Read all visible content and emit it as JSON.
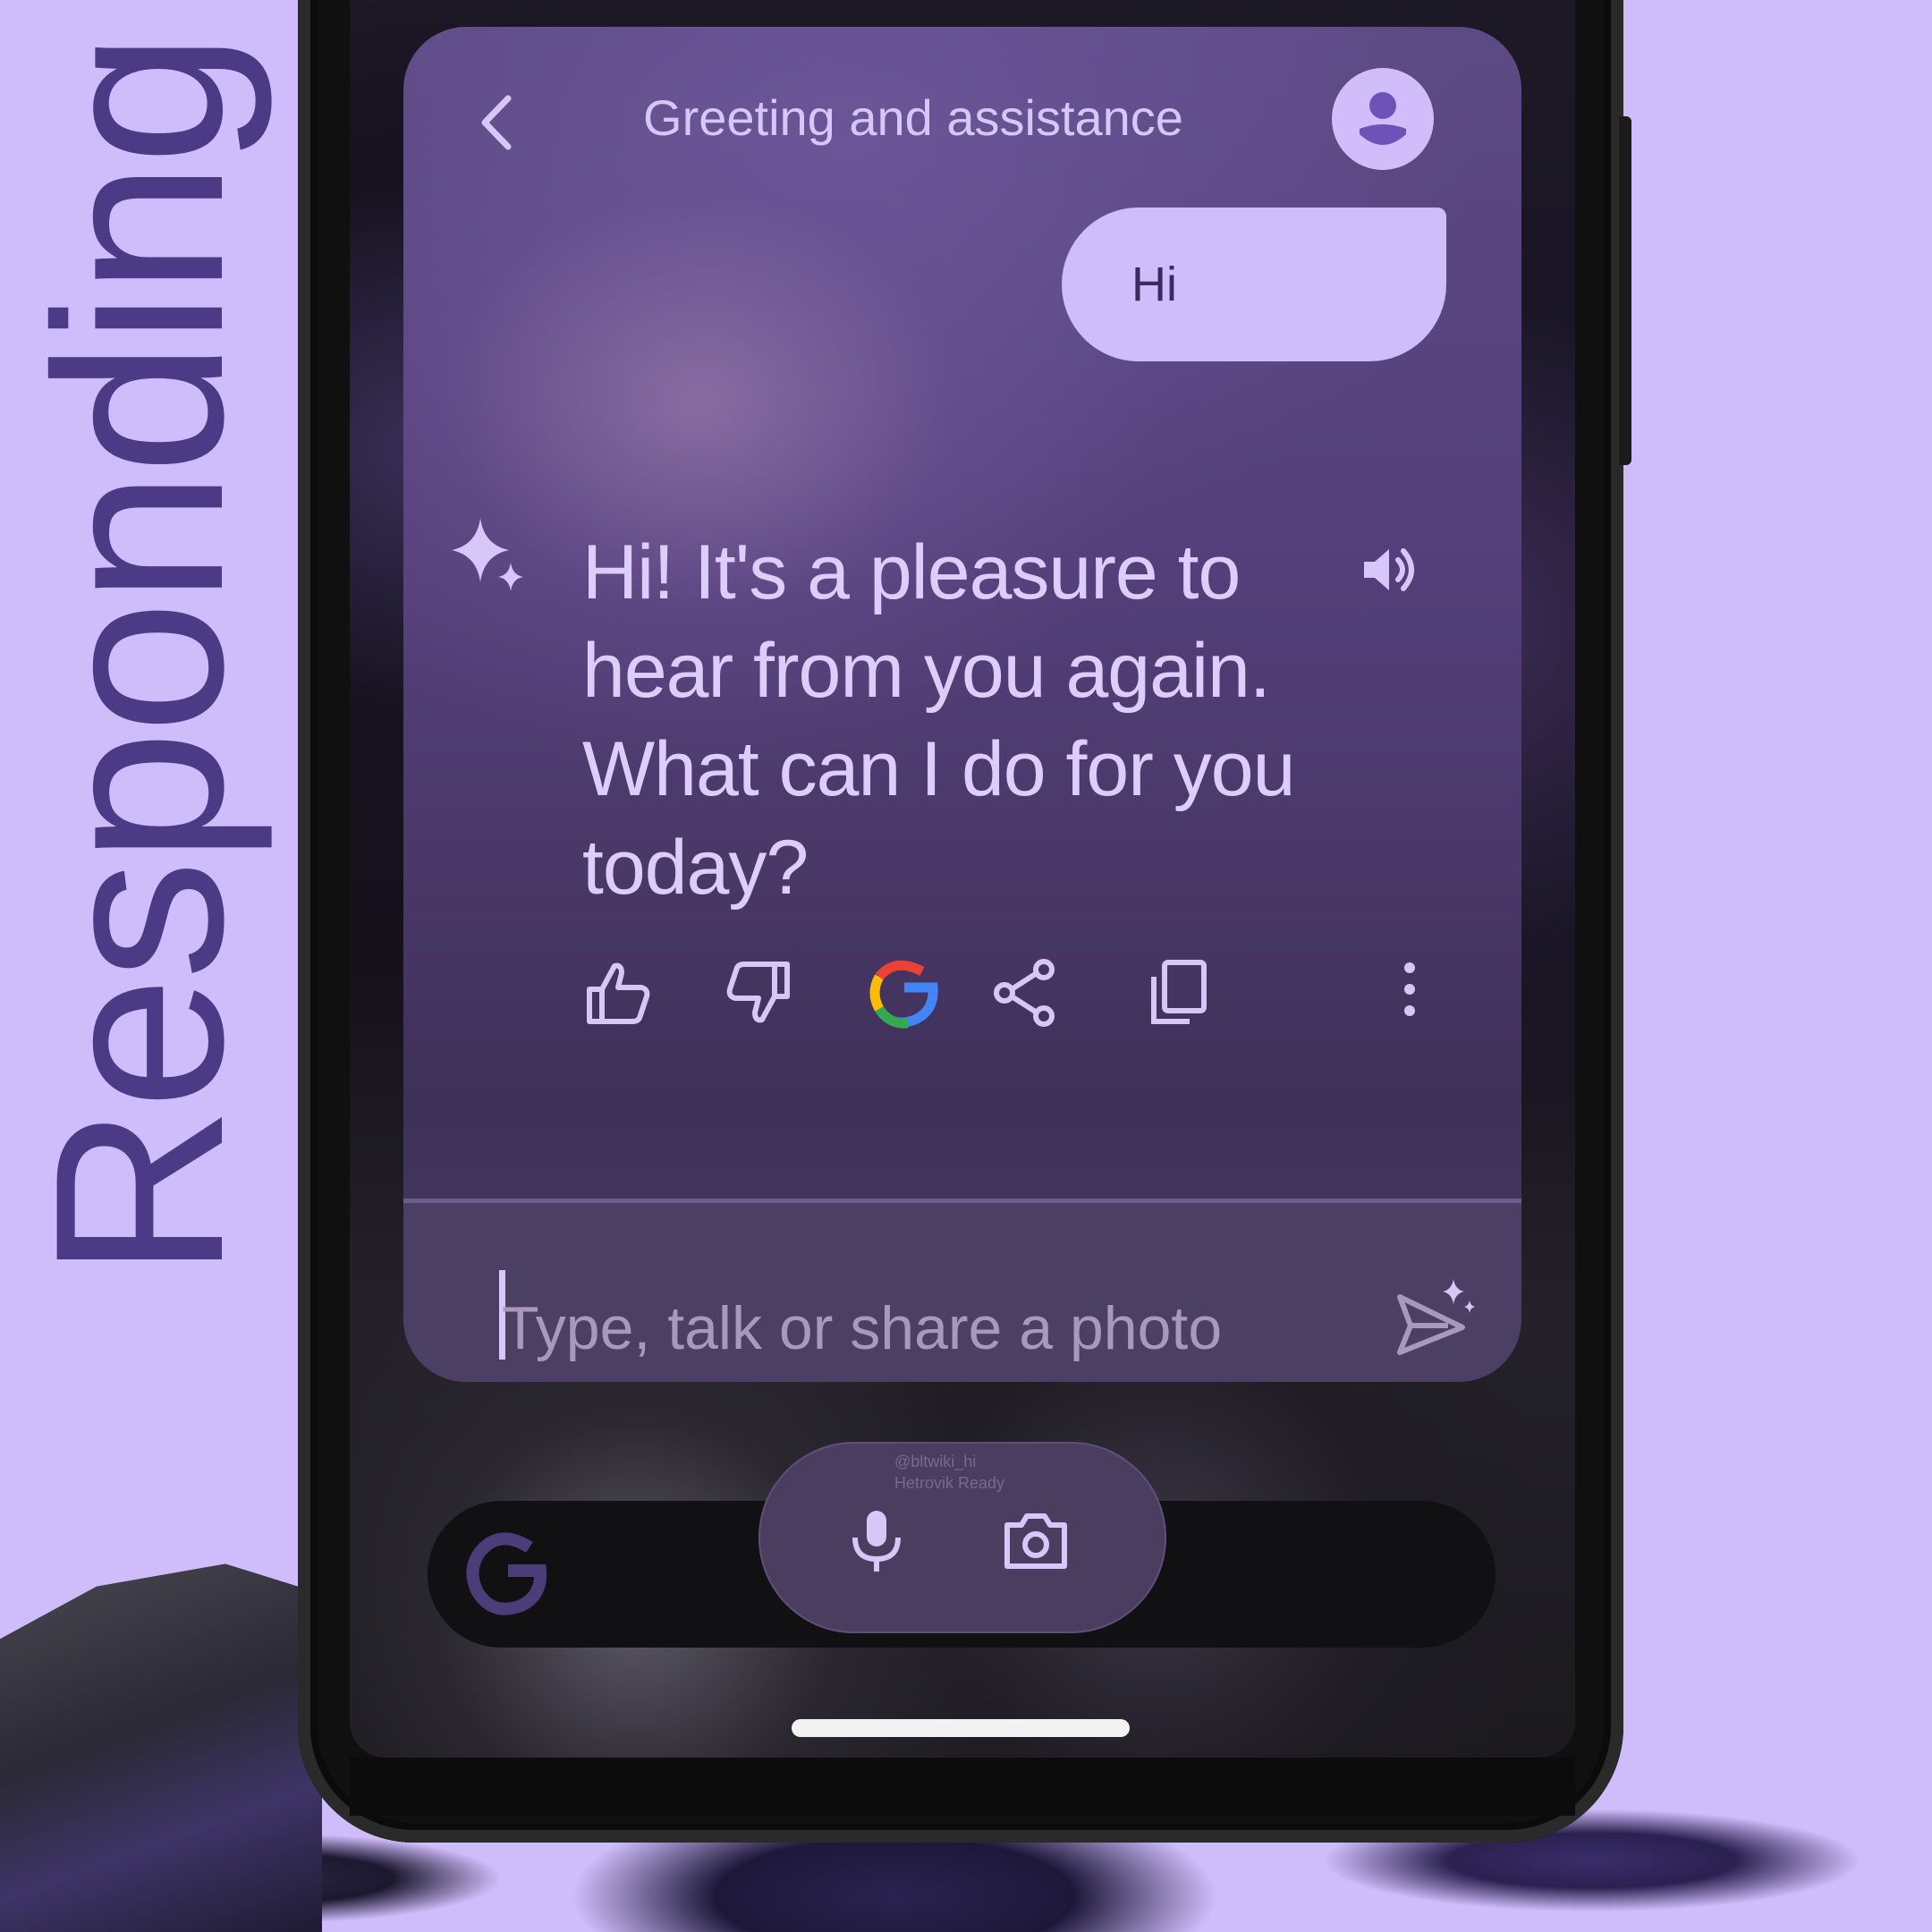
{
  "promo": {
    "side_title": "Responding"
  },
  "chat": {
    "header": {
      "title": "Greeting and assistance"
    },
    "user_message": "Hi",
    "assistant_response": "Hi! It's a pleasure to hear from you again. What can I do for you today?",
    "actions": [
      "thumbs-up-icon",
      "thumbs-down-icon",
      "google-search-icon",
      "share-icon",
      "copy-icon",
      "more-vert-icon"
    ],
    "input": {
      "placeholder": "Type, talk or share a photo"
    }
  },
  "bottom_bar": {
    "watermark_line1": "@bltwiki_hi",
    "watermark_line2": "Hetrovik Ready"
  },
  "colors": {
    "background": "#cfbcfb",
    "accent": "#4b3a86",
    "card": "#543f7a",
    "bubble": "#cfbcfb",
    "text_light": "#ddcdfb"
  }
}
